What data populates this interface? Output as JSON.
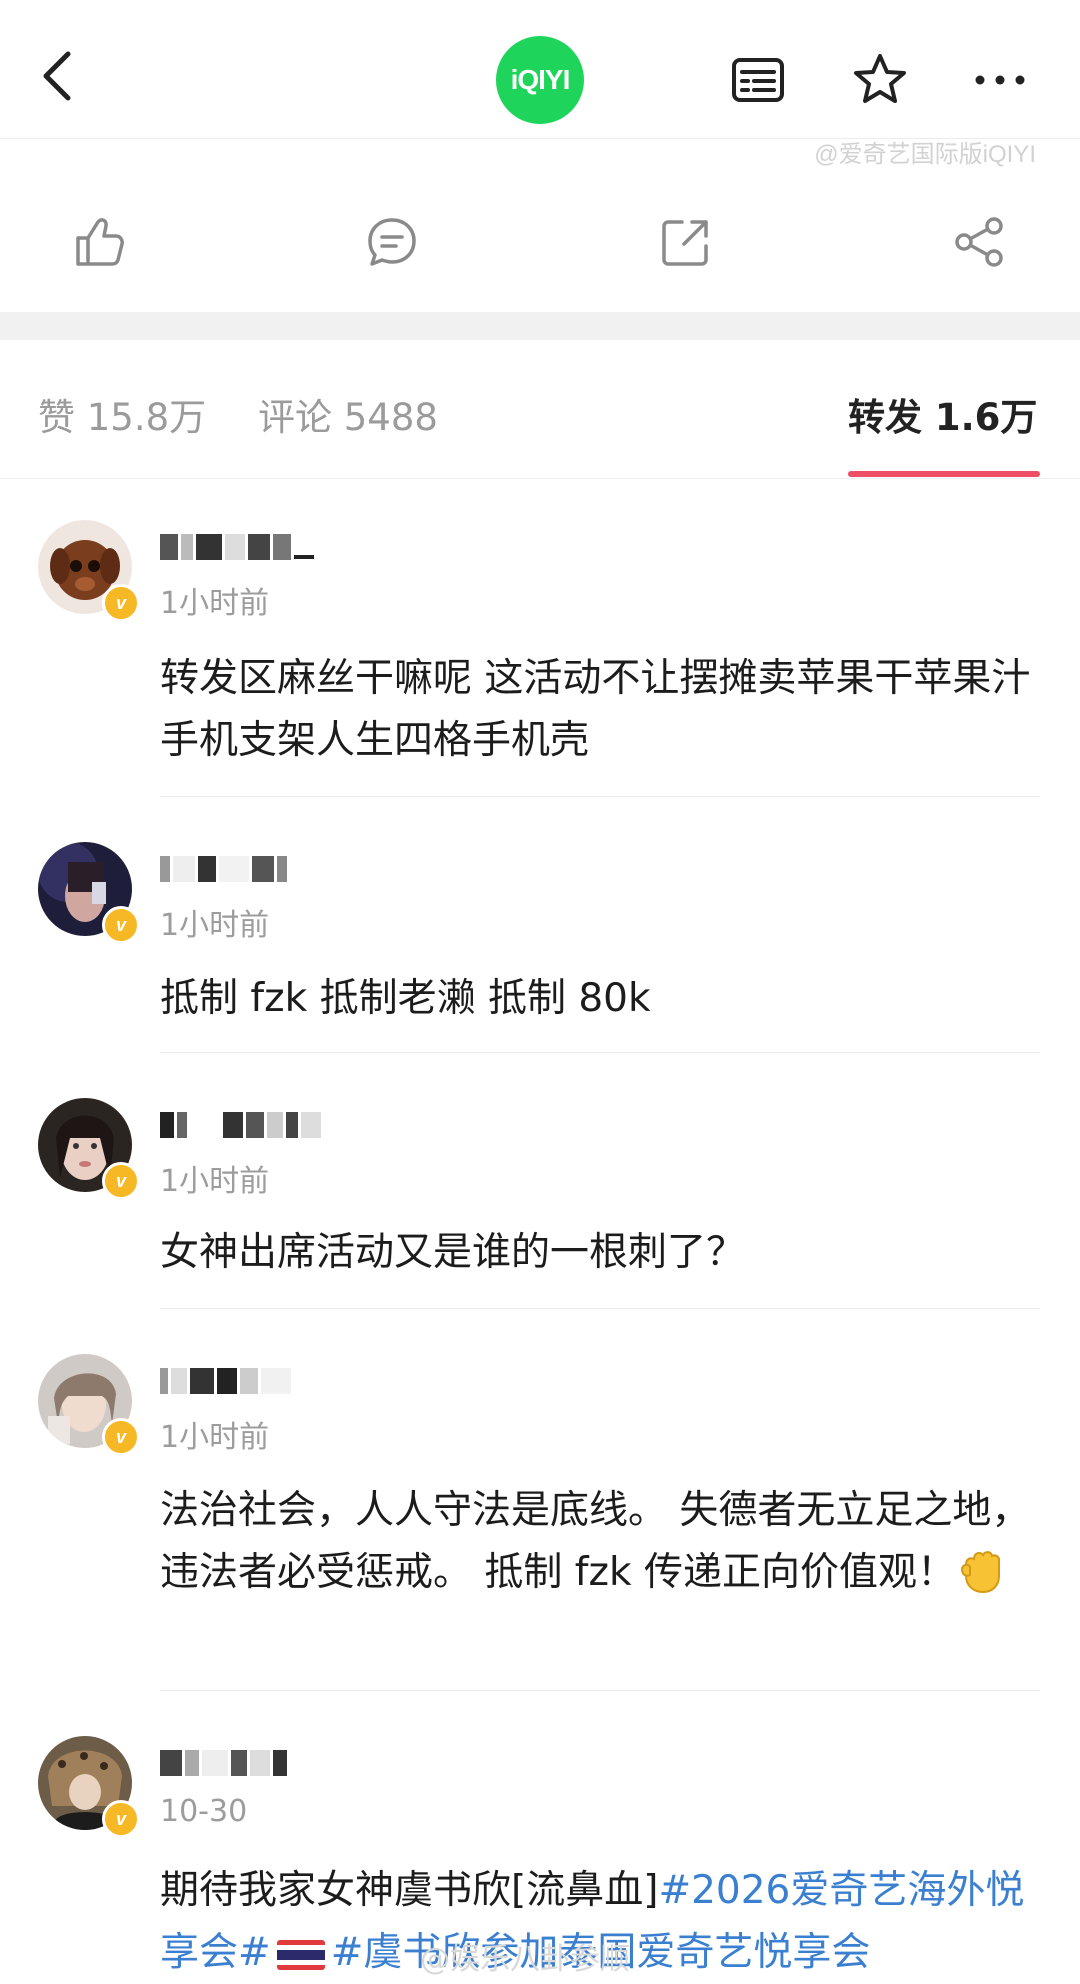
{
  "header": {
    "logo_text": "iQIYI",
    "watermark": "@爱奇艺国际版iQIYI",
    "icons": [
      "back-arrow-icon",
      "list-icon",
      "star-icon",
      "more-dots-icon"
    ]
  },
  "actions": {
    "icons": [
      "thumbs-up-icon",
      "comment-icon",
      "repost-icon",
      "share-icon"
    ]
  },
  "tabs": {
    "likes": "赞 15.8万",
    "comments": "评论 5488",
    "reposts": "转发 1.6万",
    "active": "reposts",
    "accent_color": "#ee4f67"
  },
  "feed": [
    {
      "username": "",
      "time": "1小时前",
      "content": "转发区麻丝干嘛呢 这活动不让摆摊卖苹果干苹果汁手机支架人生四格手机壳"
    },
    {
      "username": "",
      "time": "1小时前",
      "content": "抵制 fzk  抵制老濑  抵制 80k"
    },
    {
      "username": "",
      "time": "1小时前",
      "content": "女神出席活动又是谁的一根刺了？"
    },
    {
      "username": "",
      "time": "1小时前",
      "content": "法治社会，人人守法是底线。 失德者无立足之地，违法者必受惩戒。 抵制 fzk 传递正向价值观！"
    },
    {
      "username": "",
      "time": "10-30",
      "content_prefix": "期待我家女神虞书欣[流鼻血]",
      "topic1": "#2026爱奇艺海外悦享会#",
      "topic2": "#虞书欣参加泰国爱奇艺悦享会"
    }
  ],
  "watermark_bottom": "@娱乐八卦参顺",
  "colors": {
    "verified_badge": "#f6b824",
    "topic_link": "#3b7fd0",
    "logo_green": "#1fd45a"
  }
}
